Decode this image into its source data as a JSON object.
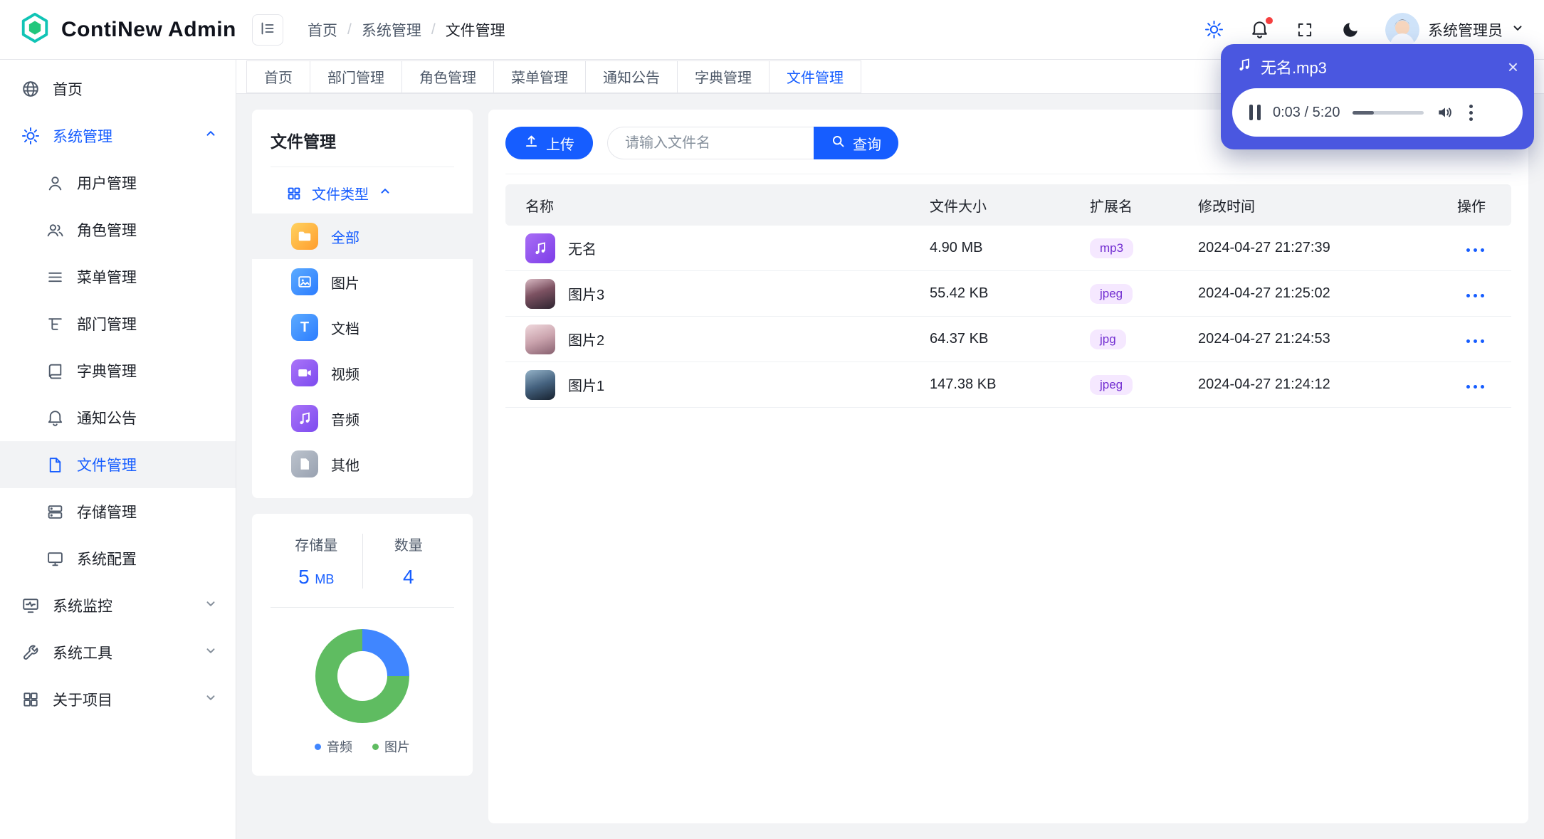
{
  "colors": {
    "primary": "#165DFF",
    "player_bg": "#4A57E0",
    "tag_bg": "#F5E8FF",
    "tag_text": "#722ED1"
  },
  "icons": {
    "close": "×",
    "doc_letter": "T"
  },
  "header": {
    "brand": "ContiNew Admin",
    "breadcrumb": [
      "首页",
      "系统管理",
      "文件管理"
    ],
    "sep": "/",
    "username": "系统管理员"
  },
  "player": {
    "title": "无名.mp3",
    "time": "0:03 / 5:20",
    "progress_percent": 30
  },
  "sidebar": {
    "items": [
      {
        "label": "首页"
      },
      {
        "label": "系统管理"
      },
      {
        "label": "用户管理"
      },
      {
        "label": "角色管理"
      },
      {
        "label": "菜单管理"
      },
      {
        "label": "部门管理"
      },
      {
        "label": "字典管理"
      },
      {
        "label": "通知公告"
      },
      {
        "label": "文件管理"
      },
      {
        "label": "存储管理"
      },
      {
        "label": "系统配置"
      },
      {
        "label": "系统监控"
      },
      {
        "label": "系统工具"
      },
      {
        "label": "关于项目"
      }
    ]
  },
  "tabs": [
    {
      "label": "首页"
    },
    {
      "label": "部门管理"
    },
    {
      "label": "角色管理"
    },
    {
      "label": "菜单管理"
    },
    {
      "label": "通知公告"
    },
    {
      "label": "字典管理"
    },
    {
      "label": "文件管理"
    }
  ],
  "filter_panel": {
    "title": "文件管理",
    "section": "文件类型",
    "types": [
      {
        "label": "全部"
      },
      {
        "label": "图片"
      },
      {
        "label": "文档"
      },
      {
        "label": "视频"
      },
      {
        "label": "音频"
      },
      {
        "label": "其他"
      }
    ],
    "stats": {
      "storage_label": "存储量",
      "storage_value": "5",
      "storage_unit": "MB",
      "count_label": "数量",
      "count_value": "4"
    }
  },
  "toolbar": {
    "upload_label": "上传",
    "search_placeholder": "请输入文件名",
    "query_label": "查询"
  },
  "table": {
    "headers": [
      "名称",
      "文件大小",
      "扩展名",
      "修改时间",
      "操作"
    ],
    "rows": [
      {
        "name": "无名",
        "size": "4.90 MB",
        "ext": "mp3",
        "time": "2024-04-27 21:27:39"
      },
      {
        "name": "图片3",
        "size": "55.42 KB",
        "ext": "jpeg",
        "time": "2024-04-27 21:25:02"
      },
      {
        "name": "图片2",
        "size": "64.37 KB",
        "ext": "jpg",
        "time": "2024-04-27 21:24:53"
      },
      {
        "name": "图片1",
        "size": "147.38 KB",
        "ext": "jpeg",
        "time": "2024-04-27 21:24:12"
      }
    ]
  },
  "chart_data": {
    "type": "pie",
    "labels": [
      "音频",
      "图片"
    ],
    "values": [
      1,
      3
    ],
    "colors": [
      "#4086FF",
      "#5FBC61"
    ]
  }
}
